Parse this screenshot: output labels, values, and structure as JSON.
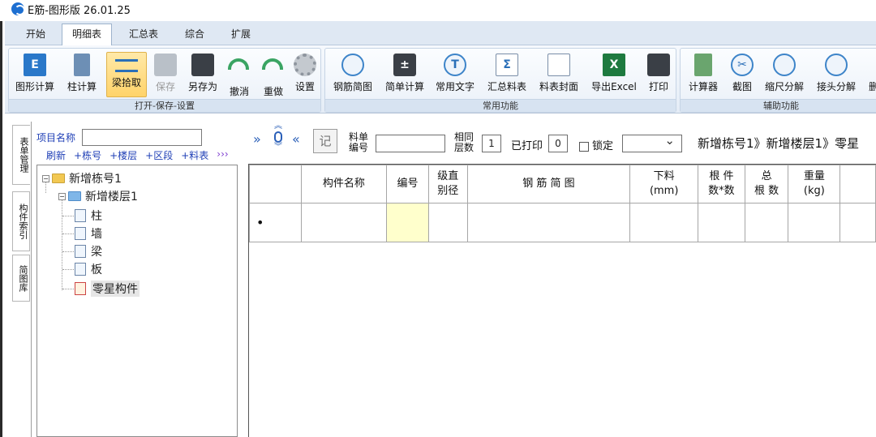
{
  "window": {
    "title": "E筋-图形版 26.01.25"
  },
  "tabs": [
    {
      "label": "开始"
    },
    {
      "label": "明细表"
    },
    {
      "label": "汇总表"
    },
    {
      "label": "综合"
    },
    {
      "label": "扩展"
    }
  ],
  "ribbon": {
    "group1": {
      "label": "打开-保存-设置",
      "buttons": [
        {
          "label": "图形计算"
        },
        {
          "label": "柱计算"
        },
        {
          "label": "梁拾取"
        },
        {
          "label": "保存"
        },
        {
          "label": "另存为"
        },
        {
          "label": "撤消"
        },
        {
          "label": "重做"
        },
        {
          "label": "设置"
        }
      ]
    },
    "group2": {
      "label": "常用功能",
      "buttons": [
        {
          "label": "钢筋简图"
        },
        {
          "label": "简单计算"
        },
        {
          "label": "常用文字"
        },
        {
          "label": "汇总料表"
        },
        {
          "label": "料表封面"
        },
        {
          "label": "导出Excel"
        },
        {
          "label": "打印"
        }
      ]
    },
    "group3": {
      "label": "辅助功能",
      "buttons": [
        {
          "label": "计算器"
        },
        {
          "label": "截图"
        },
        {
          "label": "缩尺分解"
        },
        {
          "label": "接头分解"
        },
        {
          "label": "删"
        }
      ]
    }
  },
  "left_panel": {
    "vertical_tabs": [
      {
        "label": "表单管理"
      },
      {
        "label": "构件索引"
      },
      {
        "label": "简图库"
      }
    ],
    "project_label": "项目名称",
    "project_value": "",
    "links": [
      "刷新",
      "+栋号",
      "+楼层",
      "+区段",
      "+料表",
      "›››"
    ],
    "tree": {
      "building": "新增栋号1",
      "floor": "新增楼层1",
      "items": [
        "柱",
        "墙",
        "梁",
        "板",
        "零星构件"
      ]
    }
  },
  "workbar": {
    "rec_glyph": "记",
    "sheet_no_label_1": "料单",
    "sheet_no_label_2": "编号",
    "sheet_no_value": "",
    "same_count_label_1": "相同",
    "same_count_label_2": "层数",
    "same_count_value": "1",
    "printed_label": "已打印",
    "printed_value": "0",
    "lock_label": "锁定",
    "lock_checked": false,
    "select_value": "",
    "breadcrumb": "新增栋号1》新增楼层1》零星"
  },
  "grid": {
    "headers": [
      {
        "lines": [
          "",
          ""
        ]
      },
      {
        "lines": [
          "构件名称",
          ""
        ]
      },
      {
        "lines": [
          "编号",
          ""
        ]
      },
      {
        "lines": [
          "级直",
          "别径"
        ]
      },
      {
        "lines": [
          "钢 筋 简 图",
          ""
        ]
      },
      {
        "lines": [
          "下料",
          "(mm)"
        ]
      },
      {
        "lines": [
          "根 件",
          "数*数"
        ]
      },
      {
        "lines": [
          "总",
          "根 数"
        ]
      },
      {
        "lines": [
          "重量",
          "(kg)"
        ]
      },
      {
        "lines": [
          "",
          ""
        ]
      }
    ],
    "rows": [
      {
        "marker": "•",
        "cells": [
          "",
          "",
          "",
          "",
          "",
          "",
          "",
          "",
          ""
        ]
      }
    ]
  },
  "colors": {
    "accent_blue": "#1d6fd1",
    "selected_button": "#ffd36a",
    "yellow_cell": "#ffffcc",
    "link_blue": "#1f3fb6"
  }
}
